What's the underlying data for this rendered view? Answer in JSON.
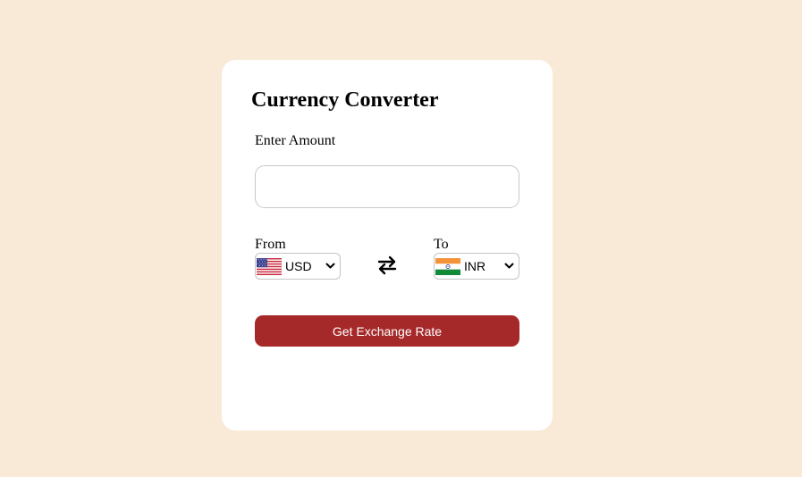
{
  "converter": {
    "title": "Currency Converter",
    "amount_label": "Enter Amount",
    "amount_value": "",
    "from": {
      "label": "From",
      "currency": "USD",
      "flag_icon": "us-flag-icon"
    },
    "to": {
      "label": "To",
      "currency": "INR",
      "flag_icon": "india-flag-icon"
    },
    "swap_icon": "swap-arrows-icon",
    "button_label": "Get Exchange Rate"
  },
  "colors": {
    "page_background": "#f9ead8",
    "card_background": "#ffffff",
    "button_background": "#a6292a",
    "button_text": "#ffffff"
  }
}
